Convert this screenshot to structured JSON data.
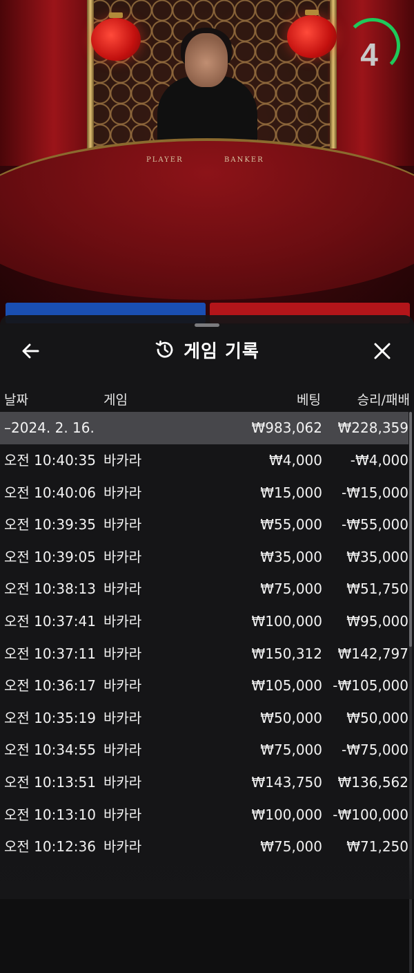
{
  "video": {
    "countdown": "4",
    "table_labels": [
      "PLAYER",
      "BANKER"
    ],
    "colors": {
      "countdown_ring": "#1ec95a",
      "player": "#1a4fb3",
      "banker": "#b3151a"
    }
  },
  "sheet": {
    "title": "게임 기록",
    "title_icon": "history-icon",
    "back_icon": "arrow-left-icon",
    "close_icon": "close-icon",
    "columns": {
      "date": "날짜",
      "game": "게임",
      "bet": "베팅",
      "win_loss": "승리/패배"
    },
    "summary": {
      "date": "–2024. 2. 16.",
      "bet": "₩983,062",
      "win_loss": "₩228,359"
    },
    "rows": [
      {
        "time": "오전 10:40:35",
        "game": "바카라",
        "bet": "₩4,000",
        "win_loss": "-₩4,000"
      },
      {
        "time": "오전 10:40:06",
        "game": "바카라",
        "bet": "₩15,000",
        "win_loss": "-₩15,000"
      },
      {
        "time": "오전 10:39:35",
        "game": "바카라",
        "bet": "₩55,000",
        "win_loss": "-₩55,000"
      },
      {
        "time": "오전 10:39:05",
        "game": "바카라",
        "bet": "₩35,000",
        "win_loss": "₩35,000"
      },
      {
        "time": "오전 10:38:13",
        "game": "바카라",
        "bet": "₩75,000",
        "win_loss": "₩51,750"
      },
      {
        "time": "오전 10:37:41",
        "game": "바카라",
        "bet": "₩100,000",
        "win_loss": "₩95,000"
      },
      {
        "time": "오전 10:37:11",
        "game": "바카라",
        "bet": "₩150,312",
        "win_loss": "₩142,797"
      },
      {
        "time": "오전 10:36:17",
        "game": "바카라",
        "bet": "₩105,000",
        "win_loss": "-₩105,000"
      },
      {
        "time": "오전 10:35:19",
        "game": "바카라",
        "bet": "₩50,000",
        "win_loss": "₩50,000"
      },
      {
        "time": "오전 10:34:55",
        "game": "바카라",
        "bet": "₩75,000",
        "win_loss": "-₩75,000"
      },
      {
        "time": "오전 10:13:51",
        "game": "바카라",
        "bet": "₩143,750",
        "win_loss": "₩136,562"
      },
      {
        "time": "오전 10:13:10",
        "game": "바카라",
        "bet": "₩100,000",
        "win_loss": "-₩100,000"
      },
      {
        "time": "오전 10:12:36",
        "game": "바카라",
        "bet": "₩75,000",
        "win_loss": "₩71,250"
      }
    ]
  }
}
